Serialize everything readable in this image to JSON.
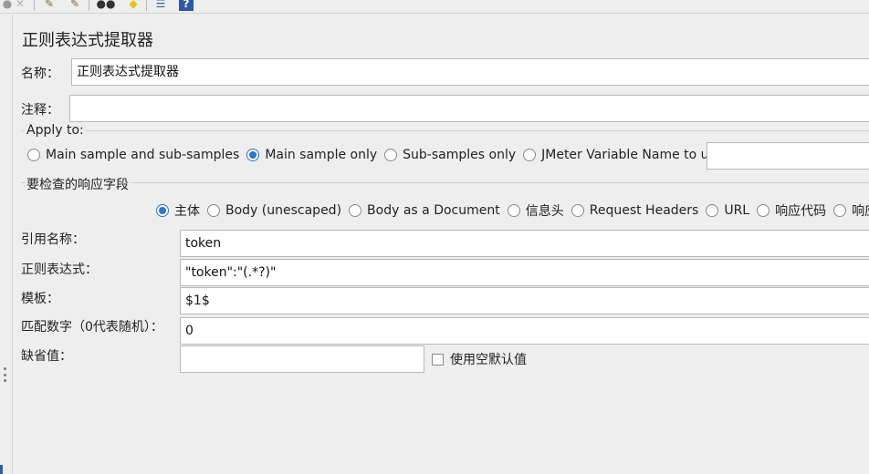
{
  "toolbar": {
    "icons": [
      "clear-icon",
      "stop-icon",
      "broom-icon",
      "broom-all-icon",
      "binoculars-icon",
      "reset-search-icon",
      "function-helper-icon",
      "help-icon"
    ],
    "glyphs": [
      "●",
      "✕",
      "✎",
      "✎",
      "●●",
      "◆",
      "☰",
      "?"
    ],
    "colors": [
      "#9a9a9a",
      "#b0b0b0",
      "#8a6a3a",
      "#8a6a3a",
      "#333333",
      "#e8c010",
      "#3a5f9e",
      "#ffffff"
    ]
  },
  "panel": {
    "title": "正则表达式提取器"
  },
  "name_field": {
    "label": "名称：",
    "value": "正则表达式提取器"
  },
  "comment_field": {
    "label": "注释：",
    "value": ""
  },
  "apply_to": {
    "legend": "Apply to:",
    "options": [
      "Main sample and sub-samples",
      "Main sample only",
      "Sub-samples only",
      "JMeter Variable Name to use"
    ],
    "selected": "Main sample only",
    "variable_value": ""
  },
  "field_to_check": {
    "legend": "要检查的响应字段",
    "options": [
      "主体",
      "Body (unescaped)",
      "Body as a Document",
      "信息头",
      "Request Headers",
      "URL",
      "响应代码",
      "响应信息"
    ],
    "selected": "主体"
  },
  "extractor": {
    "ref_name": {
      "label": "引用名称：",
      "value": "token"
    },
    "regex": {
      "label": "正则表达式：",
      "value": "\"token\":\"(.*?)\""
    },
    "template": {
      "label": "模板：",
      "value": "$1$"
    },
    "match_no": {
      "label": "匹配数字（0代表随机）：",
      "value": "0"
    },
    "default": {
      "label": "缺省值：",
      "value": "",
      "empty_checkbox_label": "使用空默认值",
      "empty_checked": false
    }
  },
  "colors": {
    "accent": "#2f75c9",
    "background": "#eeeeee",
    "field_border": "#b9b9b9"
  }
}
